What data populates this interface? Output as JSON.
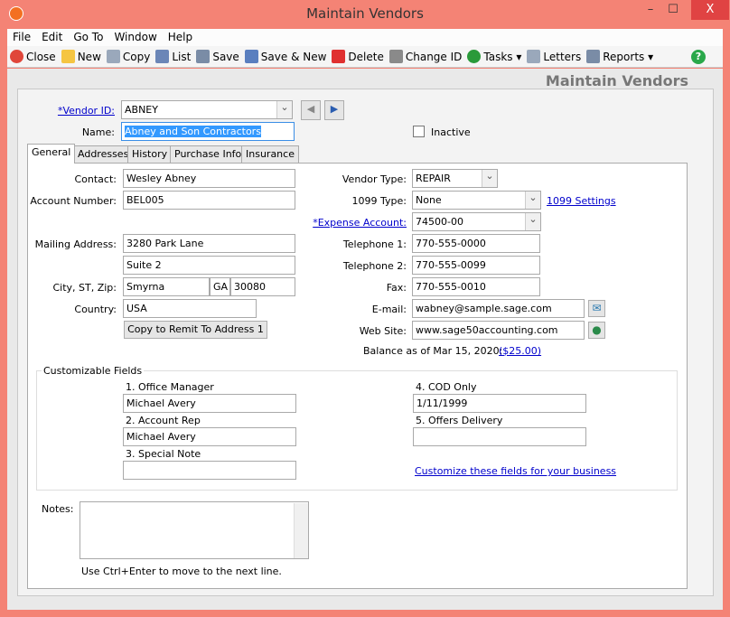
{
  "window": {
    "title": "Maintain Vendors",
    "minimize": "–",
    "maximize": "☐",
    "close": "X"
  },
  "menu": [
    "File",
    "Edit",
    "Go To",
    "Window",
    "Help"
  ],
  "toolbar": [
    {
      "label": "Close",
      "icon": "close-icon",
      "color": "#e0463a"
    },
    {
      "label": "New",
      "icon": "new-icon",
      "color": "#f5c542"
    },
    {
      "label": "Copy",
      "icon": "copy-icon",
      "color": "#9aa8bb"
    },
    {
      "label": "List",
      "icon": "list-icon",
      "color": "#6b86b7"
    },
    {
      "label": "Save",
      "icon": "save-icon",
      "color": "#7a8ca6"
    },
    {
      "label": "Save & New",
      "icon": "save-new-icon",
      "color": "#5a7fbf"
    },
    {
      "label": "Delete",
      "icon": "delete-icon",
      "color": "#e03030"
    },
    {
      "label": "Change ID",
      "icon": "change-id-icon",
      "color": "#8a8a8a"
    },
    {
      "label": "Tasks ▾",
      "icon": "tasks-icon",
      "color": "#2a9a3a"
    },
    {
      "label": "Letters",
      "icon": "letters-icon",
      "color": "#9aa8bb"
    },
    {
      "label": "Reports ▾",
      "icon": "reports-icon",
      "color": "#7a8ca6"
    }
  ],
  "help_icon": "?",
  "heading": "Maintain Vendors",
  "vendor": {
    "id_label": "*Vendor ID:",
    "id": "ABNEY",
    "name_label": "Name:",
    "name": "Abney and Son Contractors",
    "inactive_label": "Inactive",
    "inactive": false
  },
  "tabs": [
    "General",
    "Addresses",
    "History",
    "Purchase Info",
    "Insurance"
  ],
  "general": {
    "contact_label": "Contact:",
    "contact": "Wesley Abney",
    "account_label": "Account Number:",
    "account": "BEL005",
    "mailing_label": "Mailing Address:",
    "address1": "3280 Park Lane",
    "address2": "Suite 2",
    "csz_label": "City, ST, Zip:",
    "city": "Smyrna",
    "state": "GA",
    "zip": "30080",
    "country_label": "Country:",
    "country": "USA",
    "copy_button": "Copy to Remit To Address 1",
    "vendor_type_label": "Vendor Type:",
    "vendor_type": "REPAIR",
    "type1099_label": "1099 Type:",
    "type1099": "None",
    "settings1099": "1099 Settings",
    "expense_label": "*Expense Account:",
    "expense": "74500-00",
    "tel1_label": "Telephone 1:",
    "tel1": "770-555-0000",
    "tel2_label": "Telephone 2:",
    "tel2": "770-555-0099",
    "fax_label": "Fax:",
    "fax": "770-555-0010",
    "email_label": "E-mail:",
    "email": "wabney@sample.sage.com",
    "web_label": "Web Site:",
    "web": "www.sage50accounting.com",
    "balance_label": "Balance as of Mar 15, 2020:",
    "balance": "($25.00)"
  },
  "custom": {
    "title": "Customizable Fields",
    "f1_label": "1. Office Manager",
    "f1": "Michael Avery",
    "f2_label": "2. Account Rep",
    "f2": "Michael Avery",
    "f3_label": "3. Special Note",
    "f3": "",
    "f4_label": "4. COD Only",
    "f4": "1/11/1999",
    "f5_label": "5. Offers Delivery",
    "f5": "",
    "customize_link": "Customize these fields for your business"
  },
  "notes": {
    "label": "Notes:",
    "value": "",
    "hint": "Use Ctrl+Enter to move to the next line."
  }
}
